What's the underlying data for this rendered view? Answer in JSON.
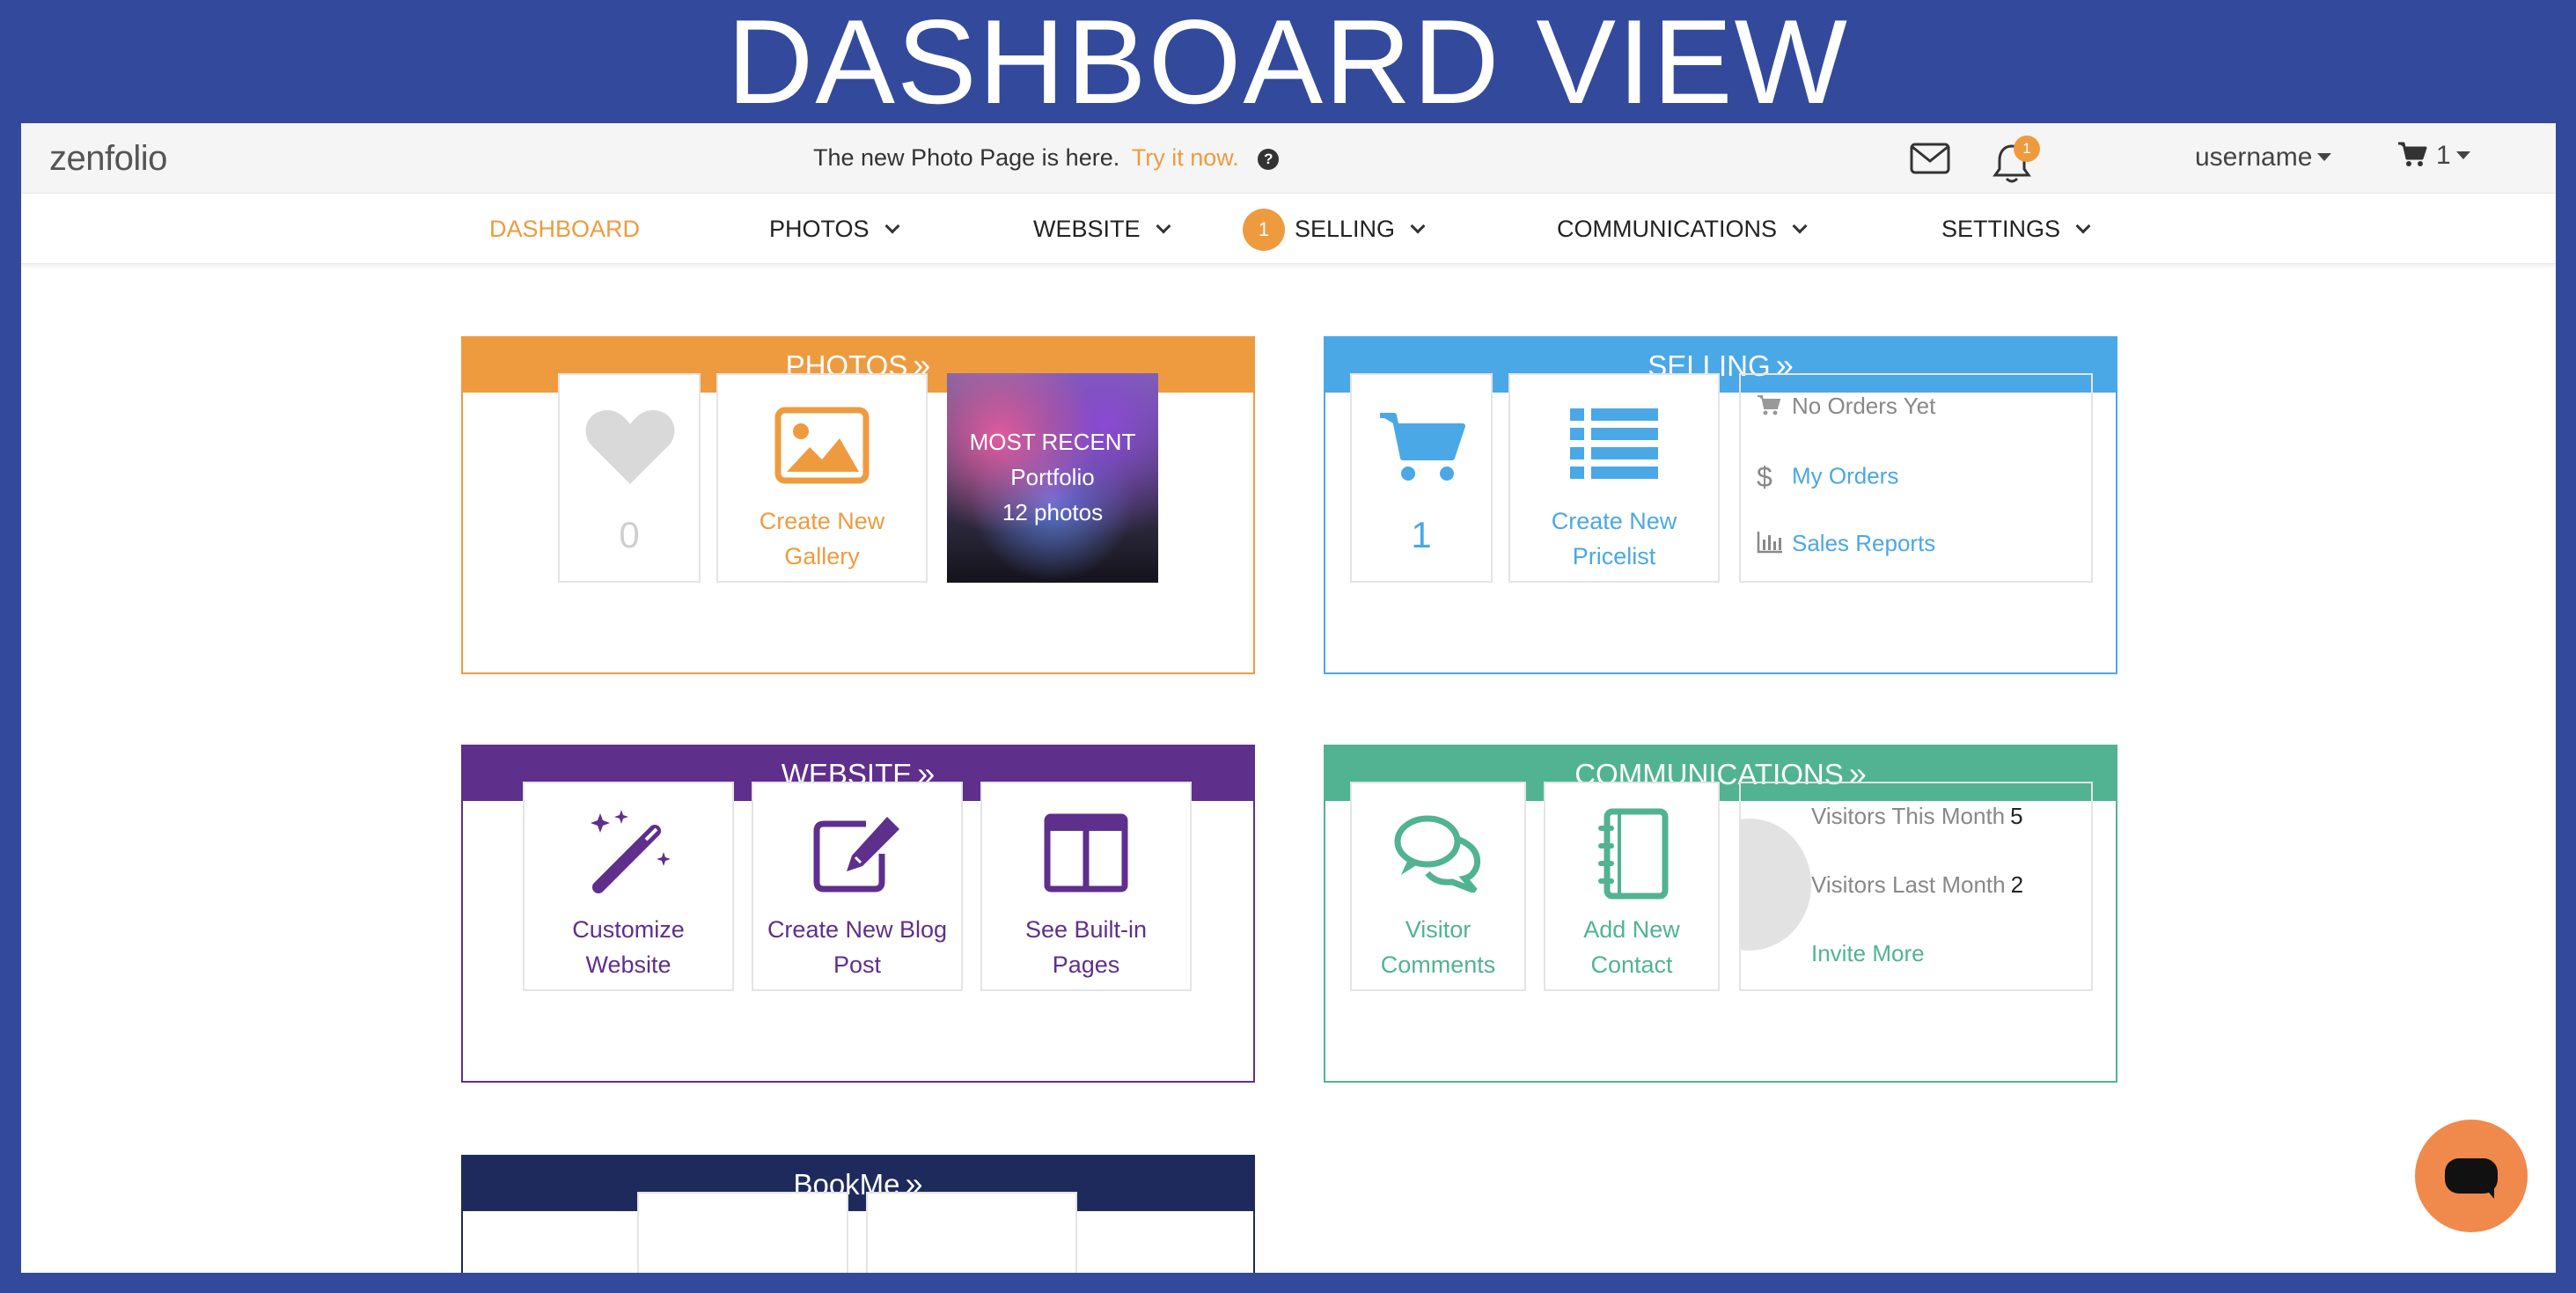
{
  "page_title": "DASHBOARD VIEW",
  "topbar": {
    "logo": "zenfolio",
    "announcement": "The new Photo Page is here.",
    "announcement_link": "Try it now.",
    "notification_count": "1",
    "username": "username",
    "cart_count": "1"
  },
  "nav": {
    "items": [
      {
        "label": "DASHBOARD"
      },
      {
        "label": "PHOTOS"
      },
      {
        "label": "WEBSITE"
      },
      {
        "label": "SELLING"
      },
      {
        "label": "COMMUNICATIONS"
      },
      {
        "label": "SETTINGS"
      }
    ],
    "selling_badge": "1"
  },
  "photos": {
    "title": "PHOTOS",
    "favorites_count": "0",
    "create_gallery": "Create New Gallery",
    "recent_label": "MOST RECENT",
    "recent_name": "Portfolio",
    "recent_count": "12 photos"
  },
  "selling": {
    "title": "SELLING",
    "cart_count": "1",
    "create_pricelist": "Create New Pricelist",
    "no_orders": "No Orders Yet",
    "my_orders": "My Orders",
    "sales_reports": "Sales Reports"
  },
  "website": {
    "title": "WEBSITE",
    "customize": "Customize Website",
    "new_blog": "Create New Blog Post",
    "built_in": "See Built-in Pages"
  },
  "communications": {
    "title": "COMMUNICATIONS",
    "visitor_comments": "Visitor Comments",
    "add_contact": "Add New Contact",
    "visitors_this_month_label": "Visitors This Month",
    "visitors_this_month": "5",
    "visitors_last_month_label": "Visitors Last Month",
    "visitors_last_month": "2",
    "invite_more": "Invite More"
  },
  "bookme": {
    "title": "BookMe"
  },
  "colors": {
    "photos": "#ee9b40",
    "selling": "#4aa8e6",
    "website": "#5f2f8c",
    "communications": "#51b391",
    "bookme": "#1f2a5c"
  }
}
